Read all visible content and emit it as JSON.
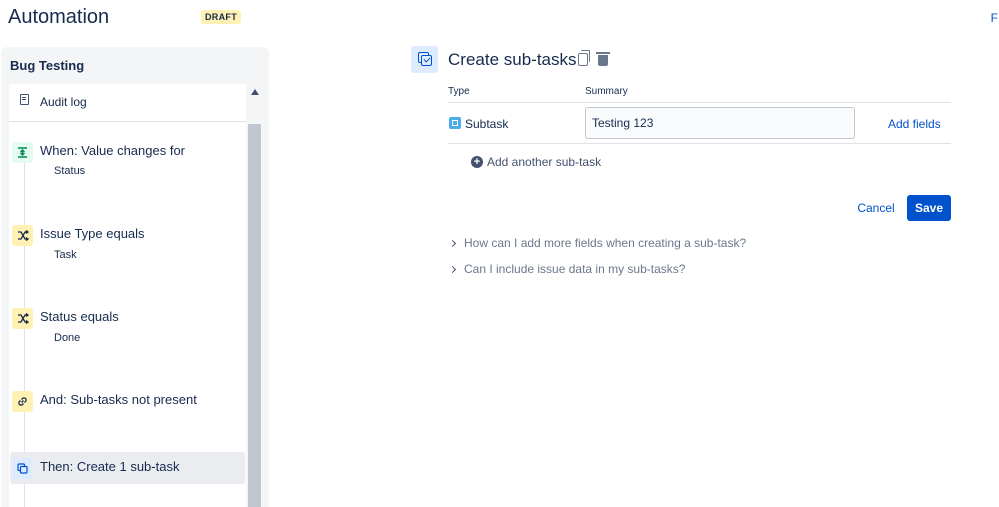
{
  "header": {
    "title": "Automation",
    "status_badge": "DRAFT",
    "top_right_text": "F"
  },
  "sidebar": {
    "rule_name": "Bug Testing",
    "audit_log_label": "Audit log",
    "components": [
      {
        "kind": "trigger",
        "icon": "trigger-icon",
        "title": "When: Value changes for",
        "subtitle": "Status"
      },
      {
        "kind": "condition",
        "icon": "shuffle-icon",
        "title": "Issue Type equals",
        "subtitle": "Task"
      },
      {
        "kind": "condition",
        "icon": "shuffle-icon",
        "title": "Status equals",
        "subtitle": "Done"
      },
      {
        "kind": "condition",
        "icon": "link-icon",
        "title": "And: Sub-tasks not present",
        "subtitle": ""
      },
      {
        "kind": "action",
        "icon": "subtask-icon",
        "title": "Then: Create 1 sub-task",
        "subtitle": "",
        "selected": true
      }
    ]
  },
  "panel": {
    "title": "Create sub-tasks",
    "columns": {
      "type": "Type",
      "summary": "Summary"
    },
    "rows": [
      {
        "type": "Subtask",
        "summary_value": "Testing 123",
        "add_fields_label": "Add fields"
      }
    ],
    "add_another_label": "Add another sub-task",
    "cancel_label": "Cancel",
    "save_label": "Save",
    "faq": [
      "How can I add more fields when creating a sub-task?",
      "Can I include issue data in my sub-tasks?"
    ]
  },
  "colors": {
    "accent": "#0052cc",
    "trigger": "#e3fcef",
    "condition": "#fff0b3",
    "action": "#deebff"
  }
}
